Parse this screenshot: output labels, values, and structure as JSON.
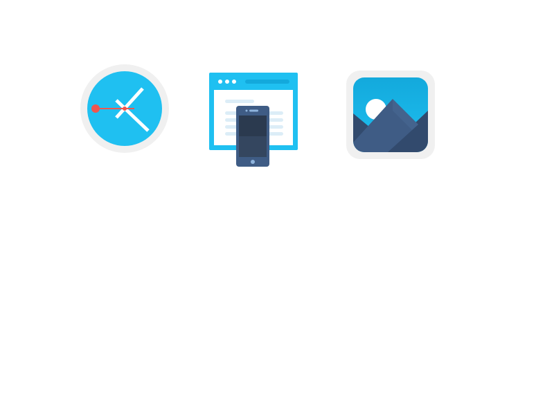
{
  "icons": [
    {
      "name": "clock-icon"
    },
    {
      "name": "responsive-design-icon"
    },
    {
      "name": "image-gallery-icon"
    }
  ],
  "colors": {
    "sky_blue": "#1fc0f1",
    "sky_blue_dark": "#13a9dc",
    "ring_gray": "#f0f0f0",
    "slate": "#3f5c85",
    "slate_dark": "#324a6d",
    "phone_screen": "#2b3a4f",
    "alert_red": "#f0554e",
    "white": "#ffffff",
    "line_pale": "#dcedf7"
  }
}
